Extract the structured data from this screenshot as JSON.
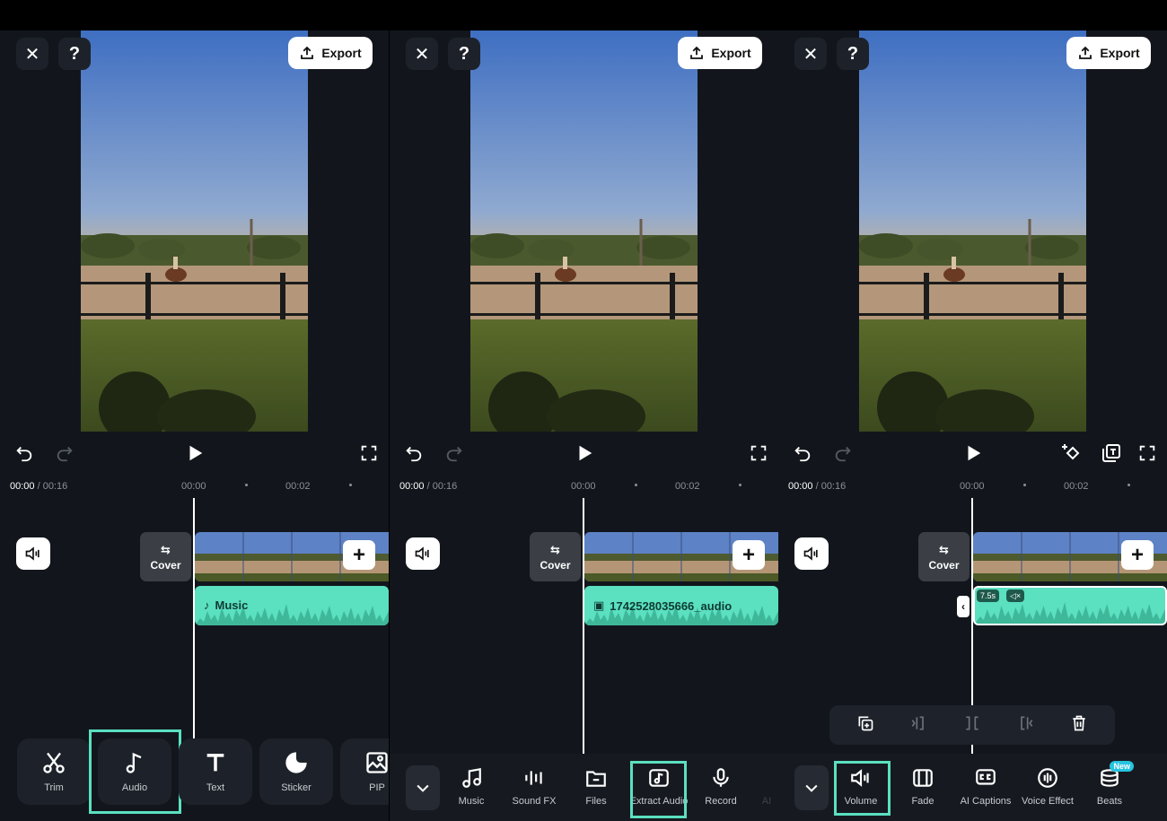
{
  "export_label": "Export",
  "close_glyph": "✕",
  "help_glyph": "?",
  "timecode": {
    "current": "00:00",
    "total": " / 00:16"
  },
  "ruler": {
    "t0": "00:00",
    "t2": "00:02"
  },
  "cover_label": "Cover",
  "panels": {
    "p1": {
      "audio_clip_label": "Music",
      "tools": [
        "Trim",
        "Audio",
        "Text",
        "Sticker",
        "PIP"
      ]
    },
    "p2": {
      "audio_clip_label": "1742528035666_audio",
      "tools": [
        "Music",
        "Sound FX",
        "Files",
        "Extract Audio",
        "Record",
        "AI"
      ]
    },
    "p3": {
      "duration_chip": "7.5s",
      "tools": [
        "Volume",
        "Fade",
        "AI Captions",
        "Voice Effect",
        "Beats"
      ],
      "new_badge": "New"
    }
  },
  "colors": {
    "accent": "#5be0c0",
    "panel_bg": "#12161c",
    "badge": "#27c4e0"
  },
  "icons": [
    "close-icon",
    "help-icon",
    "export-icon",
    "undo-icon",
    "redo-icon",
    "play-icon",
    "fullscreen-icon",
    "volume-icon",
    "swap-icon",
    "scissors-icon",
    "music-note-icon",
    "text-icon",
    "sticker-icon",
    "pip-icon",
    "chevron-down-icon",
    "sound-fx-icon",
    "folder-icon",
    "extract-audio-icon",
    "microphone-icon",
    "fade-icon",
    "ai-captions-icon",
    "voice-effect-icon",
    "beats-icon",
    "keyframe-icon",
    "text-replace-icon",
    "copy-icon",
    "split-left-icon",
    "split-icon",
    "split-right-icon",
    "delete-icon"
  ]
}
